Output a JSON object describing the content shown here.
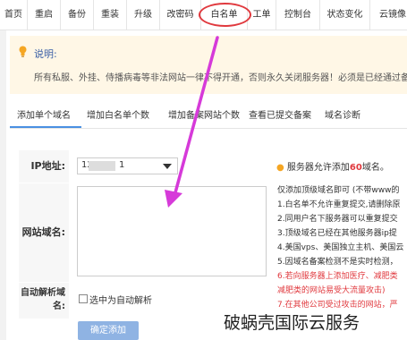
{
  "top_tabs": [
    "首页",
    "重启",
    "备份",
    "重装",
    "升级",
    "改密码",
    "白名单",
    "工单",
    "控制台",
    "状态变化",
    "云镜像"
  ],
  "notice": {
    "title": "说明:",
    "body": "所有私服、外挂、侍播病毒等非法网站一律不得开通，否则永久关闭服务器！必须是已经通过备案"
  },
  "sub_tabs": [
    "添加单个域名",
    "增加白名单个数",
    "增加备案网站个数",
    "查看已提交备案",
    "域名诊断"
  ],
  "form": {
    "ip_label": "IP地址:",
    "ip_value_prefix": "12",
    "ip_value_suffix": "1",
    "domain_label": "网站域名:",
    "autoresolve_label_line1": "自动解析域",
    "autoresolve_label_line2": "名:",
    "autoresolve_option": "选中为自动解析",
    "submit": "确定添加"
  },
  "tip": {
    "prefix": "服务器允许添加",
    "count": "60",
    "suffix": "域名。"
  },
  "rules": [
    {
      "text": "仅添加顶级域名即可 (不带www的",
      "color": "normal"
    },
    {
      "text": "1.白名单不允许重复提交,请删除原",
      "color": "normal"
    },
    {
      "text": "2.同用户名下服务器可以重复提交",
      "color": "normal"
    },
    {
      "text": "3.顶级域名已经在其他服务器ip提",
      "color": "normal"
    },
    {
      "text": "4.美国vps、美国独立主机、美国云",
      "color": "normal"
    },
    {
      "text": "5.因域名备案检测不是实时检测，",
      "color": "normal"
    },
    {
      "text": "6.若向服务器上添加医疗、减肥类",
      "color": "red"
    },
    {
      "text": "减肥类的网站易受大流量攻击)",
      "color": "red"
    },
    {
      "text": "7.在其他公司受过攻击的网站，严",
      "color": "red"
    }
  ],
  "watermark": "破蜗壳国际云服务",
  "colors": {
    "accent": "#4a90e2",
    "alert": "#e0393e",
    "arrow": "#d63ad9",
    "notice_bg": "#fff7e6"
  }
}
